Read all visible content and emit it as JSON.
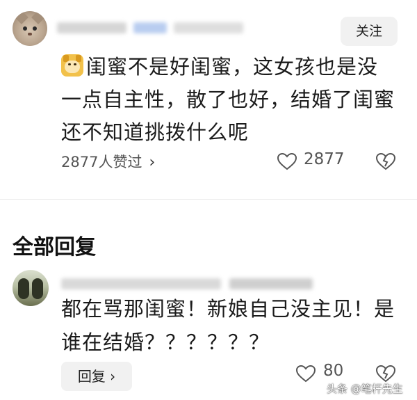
{
  "comment": {
    "follow_label": "关注",
    "text_lines": [
      "闺蜜不是好闺蜜，这女孩也是没",
      "一点自主性，散了也好，结婚了闺蜜",
      "还不知道挑拨什么呢"
    ],
    "likes_summary": "2877人赞过",
    "chevron": "›",
    "like_count": "2877",
    "emoji": "doge-emoji"
  },
  "replies_section": {
    "title": "全部回复"
  },
  "reply": {
    "text_lines": [
      "都在骂那闺蜜！新娘自己没主见！是",
      "谁在结婚？？？？？？"
    ],
    "reply_label": "回复",
    "reply_chevron": "›",
    "like_count": "80"
  },
  "watermark": "头条 @笔杆先生",
  "icons": {
    "like": "heart-outline-icon",
    "dislike": "broken-heart-icon"
  },
  "colors": {
    "text": "#1a1a1a",
    "muted": "#555555",
    "button_bg": "#f1f1f1"
  }
}
